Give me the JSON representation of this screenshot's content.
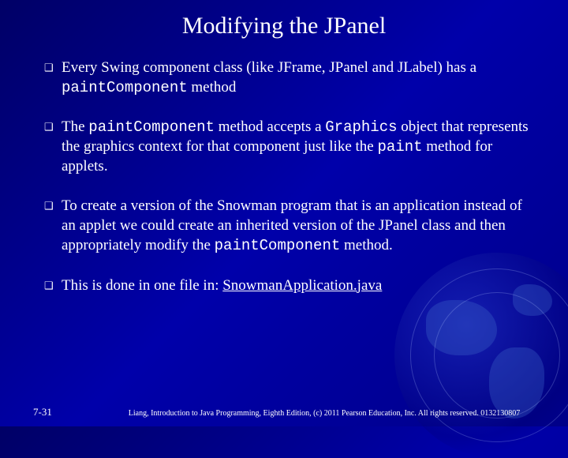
{
  "title": "Modifying the JPanel",
  "bullets": [
    {
      "pre": "Every Swing component class (like JFrame, JPanel and JLabel) has a ",
      "code1": "paintComponent",
      "post": " method"
    },
    {
      "pre": "The ",
      "code1": "paintComponent",
      "mid1": " method accepts a ",
      "code2": "Graphics",
      "mid2": " object that represents the graphics context for that component just like the ",
      "code3": "paint",
      "post": " method for applets."
    },
    {
      "pre": "To create a version of the Snowman program that is an application instead of an applet we could create an inherited version of the JPanel class and then appropriately modify the ",
      "code1": "paintComponent",
      "post": " method."
    },
    {
      "pre": "This is done in one file in: ",
      "link": "SnowmanApplication.java"
    }
  ],
  "page_number": "7-31",
  "copyright": "Liang, Introduction to Java Programming, Eighth Edition, (c) 2011 Pearson Education, Inc. All rights reserved. 0132130807",
  "bullet_marker": "❑"
}
